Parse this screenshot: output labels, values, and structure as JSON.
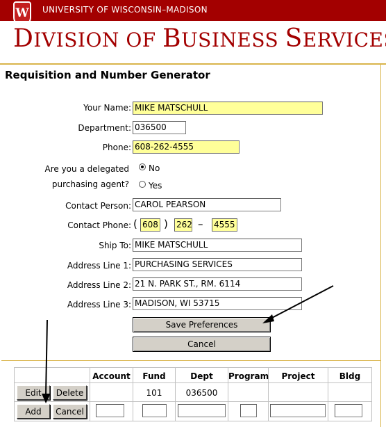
{
  "header": {
    "university": "UNIVERSITY OF WISCONSIN–MADISON",
    "division_title_cap1": "D",
    "division_title_rest1": "IVISION OF ",
    "division_title_cap2": "B",
    "division_title_rest2": "USINESS ",
    "division_title_cap3": "S",
    "division_title_rest3": "ERVICES",
    "crest_letter": "W"
  },
  "page_title": "Requisition and Number Generator",
  "form": {
    "your_name_label": "Your Name:",
    "your_name_value": "MIKE MATSCHULL",
    "department_label": "Department:",
    "department_value": "036500",
    "phone_label": "Phone:",
    "phone_value": "608-262-4555",
    "delegated_label_line1": "Are you a delegated",
    "delegated_label_line2": "purchasing agent?",
    "delegated_options": [
      "No",
      "Yes"
    ],
    "delegated_selected": "No",
    "contact_person_label": "Contact Person:",
    "contact_person_value": "CAROL PEARSON",
    "contact_phone_label": "Contact Phone:",
    "contact_phone_open": "(",
    "contact_phone_close": ")",
    "contact_phone_dash": "–",
    "contact_phone_area": "608",
    "contact_phone_prefix": "262",
    "contact_phone_line": "4555",
    "ship_to_label": "Ship To:",
    "ship_to_value": "MIKE MATSCHULL",
    "address1_label": "Address Line 1:",
    "address1_value": "PURCHASING SERVICES",
    "address2_label": "Address Line 2:",
    "address2_value": "21 N. PARK ST., RM. 6114",
    "address3_label": "Address Line 3:",
    "address3_value": "MADISON, WI 53715",
    "save_button": "Save Preferences",
    "cancel_button": "Cancel"
  },
  "funding_table": {
    "columns": [
      "Account",
      "Fund",
      "Dept",
      "Program",
      "Project",
      "Bldg"
    ],
    "row": {
      "edit_label": "Edit",
      "delete_label": "Delete",
      "account": "",
      "fund": "101",
      "dept": "036500",
      "program": "",
      "project": "",
      "bldg": ""
    },
    "new_row": {
      "add_label": "Add",
      "cancel_label": "Cancel"
    }
  },
  "colors": {
    "brand_red": "#a30000",
    "highlight_yellow": "#ffff99",
    "gold_rule": "#d9b44a"
  }
}
